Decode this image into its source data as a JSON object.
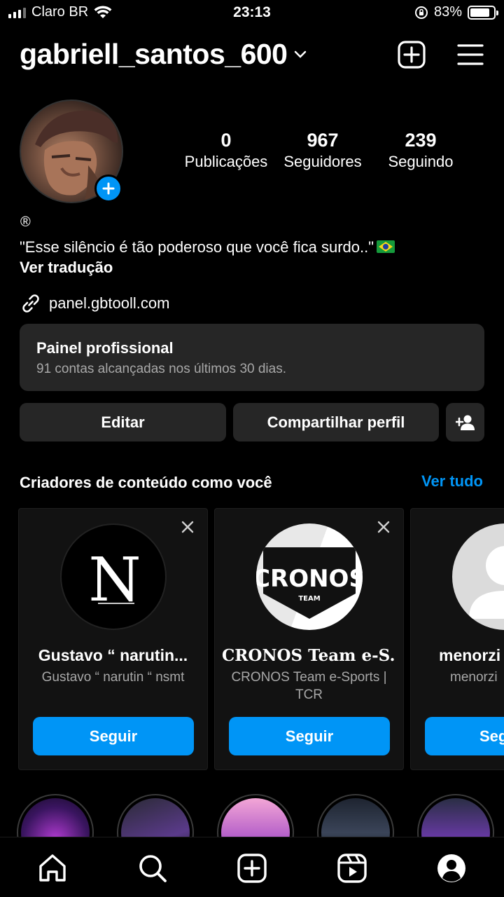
{
  "status": {
    "carrier": "Claro BR",
    "time": "23:13",
    "battery": "83%",
    "battery_level": 0.83
  },
  "header": {
    "username": "gabriell_santos_600"
  },
  "profile": {
    "stats": [
      {
        "num": "0",
        "label": "Publicações"
      },
      {
        "num": "967",
        "label": "Seguidores"
      },
      {
        "num": "239",
        "label": "Seguindo"
      }
    ],
    "registered": "®",
    "bio": "\"Esse silêncio é tão poderoso que você fica surdo..\"",
    "translate": "Ver tradução",
    "link": "panel.gbtooll.com"
  },
  "pro_panel": {
    "title": "Painel profissional",
    "subtitle": "91 contas alcançadas nos últimos 30 dias."
  },
  "actions": {
    "edit": "Editar",
    "share": "Compartilhar perfil"
  },
  "suggestions": {
    "title": "Criadores de conteúdo como você",
    "see_all": "Ver tudo",
    "cards": [
      {
        "name": "Gustavo “ narutin...",
        "sub": "Gustavo “ narutin “ nsmt",
        "follow": "Seguir",
        "avatar_text": "N"
      },
      {
        "name": "CRONOS Team e-S...",
        "sub": "CRONOS Team e-Sports | TCR",
        "follow": "Seguir",
        "avatar_text": "CRONOS",
        "avatar_sub": "TEAM"
      },
      {
        "name": "menorzi",
        "sub": "menorzi",
        "follow": "Seg"
      }
    ]
  },
  "colors": {
    "accent": "#0095f6",
    "card": "#262626"
  }
}
